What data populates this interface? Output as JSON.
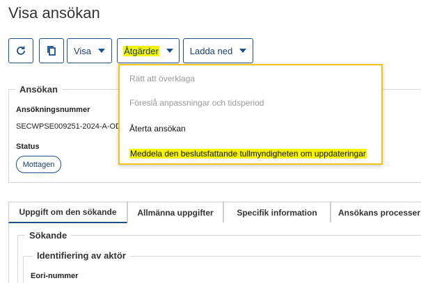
{
  "page": {
    "title": "Visa ansökan"
  },
  "toolbar": {
    "refresh_icon": "refresh-icon",
    "copy_icon": "copy-icon",
    "visa_label": "Visa",
    "atgarder_label": "Åtgärder",
    "ladda_ned_label": "Ladda ned"
  },
  "dropdown": {
    "items": [
      {
        "label": "Rätt att överklaga",
        "enabled": false
      },
      {
        "label": "Föreslå anpassningar och tidsperiod",
        "enabled": false
      },
      {
        "label": "Återta ansökan",
        "enabled": true
      },
      {
        "label": "Meddela den beslutsfattande tullmyndigheten om uppdateringar",
        "enabled": true,
        "highlighted": true
      }
    ]
  },
  "ansokan": {
    "legend": "Ansökan",
    "number_label": "Ansökningsnummer",
    "number_value": "SECWPSE009251-2024-A-OD",
    "status_label": "Status",
    "status_value": "Mottagen"
  },
  "tabs": [
    {
      "label": "Uppgift om den sökande",
      "active": true
    },
    {
      "label": "Allmänna uppgifter",
      "active": false
    },
    {
      "label": "Specifik information",
      "active": false
    },
    {
      "label": "Ansökans processer",
      "active": false
    }
  ],
  "panel": {
    "sokande_legend": "Sökande",
    "identifiering_legend": "Identifiering av aktör",
    "eori_label": "Eori-nummer"
  },
  "colors": {
    "accent": "#1a4f8b",
    "highlight": "#f4f400",
    "dropdown_border": "#f0c419"
  }
}
